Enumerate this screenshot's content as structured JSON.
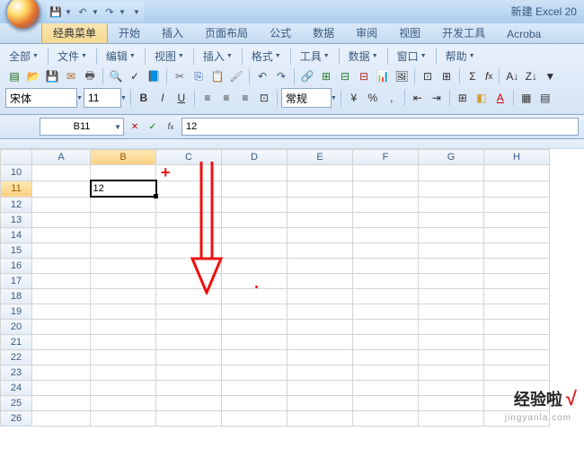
{
  "title": "新建 Excel 20",
  "qat_items": [
    "save-icon",
    "undo-icon",
    "redo-icon"
  ],
  "tabs": {
    "items": [
      "经典菜单",
      "开始",
      "插入",
      "页面布局",
      "公式",
      "数据",
      "审阅",
      "视图",
      "开发工具",
      "Acroba"
    ],
    "active_index": 0
  },
  "menubar": {
    "items": [
      "全部",
      "文件",
      "编辑",
      "视图",
      "插入",
      "格式",
      "工具",
      "数据",
      "窗口",
      "帮助"
    ]
  },
  "toolbar2": {
    "常规": "常规"
  },
  "font": {
    "name": "宋体",
    "size": "11"
  },
  "namebox": "B11",
  "formula": "12",
  "columns": [
    "A",
    "B",
    "C",
    "D",
    "E",
    "F",
    "G",
    "H"
  ],
  "rows": [
    "10",
    "11",
    "12",
    "13",
    "14",
    "15",
    "16",
    "17",
    "18",
    "19",
    "20",
    "21",
    "22",
    "23",
    "24",
    "25",
    "26"
  ],
  "active_col": "B",
  "active_row": "11",
  "cells": {
    "B11": "12"
  },
  "watermark": {
    "brand": "经验啦",
    "check": "√",
    "sub": "jingyanla.com"
  }
}
